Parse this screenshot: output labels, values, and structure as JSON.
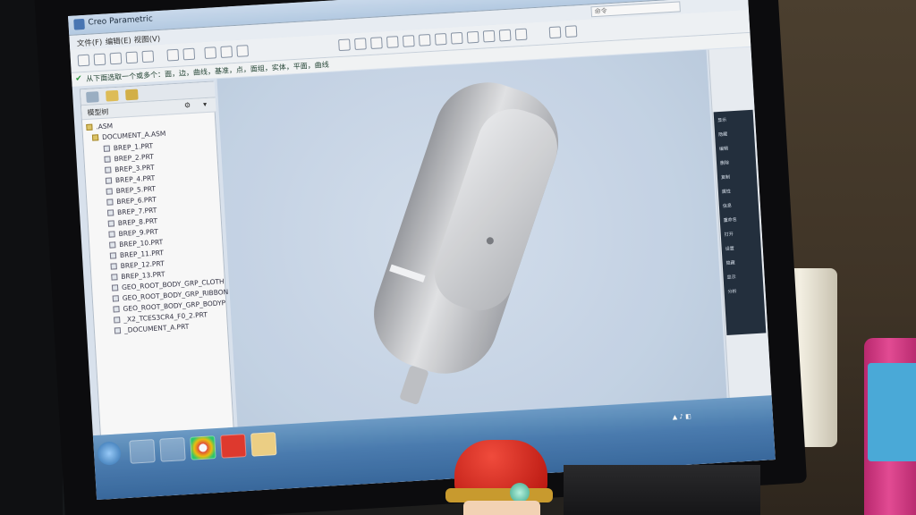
{
  "window": {
    "title": "Creo Parametric"
  },
  "menubar": {
    "items": [
      "文件(F)",
      "编辑(E)",
      "视图(V)"
    ]
  },
  "hint": {
    "text": "从下面选取一个或多个：面，边，曲线，基准，点，面组，实体，平面，曲线"
  },
  "search": {
    "placeholder": "命令"
  },
  "model_tree": {
    "header": "模型树",
    "root": ".ASM",
    "items": [
      "DOCUMENT_A.ASM",
      "BREP_1.PRT",
      "BREP_2.PRT",
      "BREP_3.PRT",
      "BREP_4.PRT",
      "BREP_5.PRT",
      "BREP_6.PRT",
      "BREP_7.PRT",
      "BREP_8.PRT",
      "BREP_9.PRT",
      "BREP_10.PRT",
      "BREP_11.PRT",
      "BREP_12.PRT",
      "BREP_13.PRT",
      "GEO_ROOT_BODY_GRP_CLOTH",
      "GEO_ROOT_BODY_GRP_RIBBON",
      "GEO_ROOT_BODY_GRP_BODYP",
      "_X2_TCES3CR4_F0_2.PRT",
      "_DOCUMENT_A.PRT"
    ]
  },
  "context_menu": {
    "items": [
      "显示",
      "隐藏",
      "编辑",
      "删除",
      "复制",
      "属性",
      "信息",
      "重命名",
      "打开",
      "设置",
      "隐藏",
      "显示",
      "分析"
    ]
  },
  "colors": {
    "model": "#d6d7da",
    "viewport_bg": "#c9d8ea",
    "taskbar": "#4c7fb3"
  }
}
